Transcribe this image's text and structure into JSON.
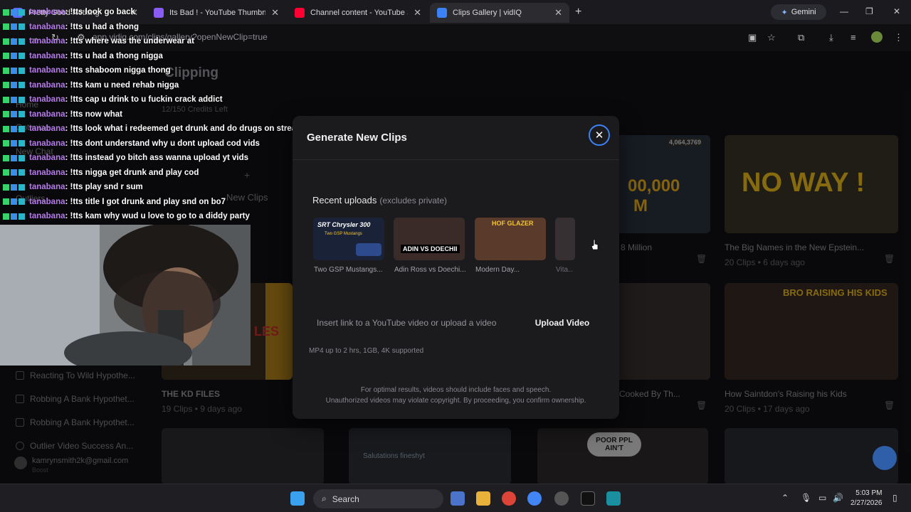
{
  "browser": {
    "tabs": [
      {
        "label": "Pretty Good Nothing",
        "icon": "globe-icon",
        "color": "#5a6dff",
        "active": false
      },
      {
        "label": "Its Bad ! - YouTube Thumbnail",
        "icon": "shield-icon",
        "color": "#8a5cf6",
        "active": false
      },
      {
        "label": "Channel content - YouTube Stu",
        "icon": "youtube-icon",
        "color": "#ff0033",
        "active": false
      },
      {
        "label": "Clips Gallery | vidIQ",
        "icon": "vidiq-icon",
        "color": "#3b82f6",
        "active": true
      }
    ],
    "new_tab": "+",
    "gemini_label": "Gemini",
    "url": "app.vidiq.com/clips/gallery?openNewClip=true"
  },
  "chat": {
    "lines": [
      {
        "user": "tanabana",
        "msg": ": !tts look go back"
      },
      {
        "user": "tanabana",
        "msg": ": !tts u had a thong"
      },
      {
        "user": "tanabana",
        "msg": ": !tts where was the underwear at"
      },
      {
        "user": "tanabana",
        "msg": ": !tts u had a thong nigga"
      },
      {
        "user": "tanabana",
        "msg": ": !tts shaboom nigga thong"
      },
      {
        "user": "tanabana",
        "msg": ": !tts kam u need rehab nigga"
      },
      {
        "user": "tanabana",
        "msg": ": !tts cap u drink to u fuckin crack addict"
      },
      {
        "user": "tanabana",
        "msg": ": !tts now what"
      },
      {
        "user": "tanabana",
        "msg": ": !tts look what i redeemed get drunk and do drugs on stream"
      },
      {
        "user": "tanabana",
        "msg": ": !tts dont understand why u dont upload cod vids"
      },
      {
        "user": "tanabana",
        "msg": ": !tts instead yo bitch ass wanna upload yt vids"
      },
      {
        "user": "tanabana",
        "msg": ": !tts nigga get drunk and play cod"
      },
      {
        "user": "tanabana",
        "msg": ": !tts play snd r sum"
      },
      {
        "user": "tanabana",
        "msg": ": !tts title I got drunk and play snd on bo7"
      },
      {
        "user": "tanabana",
        "msg": ": !tts kam why wud u love to go to a diddy party"
      }
    ]
  },
  "page": {
    "title": "Clipping",
    "credits": "12/150 Credits Left",
    "sidebar": [
      "Home",
      "Optimize",
      "New Chat",
      "Outliers"
    ],
    "history": [
      "Reacting To Wild Hypothe...",
      "Robbing A Bank Hypothet...",
      "Robbing A Bank Hypothet...",
      "Outlier Video Success An..."
    ],
    "account": "kamrynsmith2k@gmail.com",
    "account_plan": "Boost",
    "new_clips": "New Clips",
    "cards": [
      {
        "title": "8 Million",
        "meta": ""
      },
      {
        "title": "The Big Names in the New Epstein...",
        "meta": "20 Clips • 6 days ago"
      },
      {
        "title": "THE KD FILES",
        "meta": "19 Clips • 9 days ago"
      },
      {
        "title": "Cooked By Th...",
        "meta": ""
      },
      {
        "title": "How Saintdon's Raising his Kids",
        "meta": "20 Clips • 17 days ago"
      }
    ],
    "thumb_texts": {
      "noway": "NO WAY !",
      "money": "00,000",
      "money2": "M",
      "counter": "4,064,3769",
      "kids": "BRO RAISING HIS KIDS",
      "poor": "POOR PPL AIN'T",
      "salutations": "Salutations fineshyt",
      "les": "LES"
    }
  },
  "modal": {
    "title": "Generate New Clips",
    "recent_label": "Recent uploads",
    "recent_sub": "(excludes private)",
    "uploads": [
      {
        "label": "Two GSP Mustangs...",
        "thumb_text": "SRT Chrysler 300",
        "thumb_sub": "Two GSP Mustangs"
      },
      {
        "label": "Adin Ross vs Doechi...",
        "thumb_text": "ADIN VS DOECHII"
      },
      {
        "label": "Modern Day...",
        "thumb_text": "HOF GLAZER"
      },
      {
        "label": "Vita..."
      }
    ],
    "input_placeholder": "Insert link to a YouTube video or upload a video",
    "upload_button": "Upload Video",
    "formats": "MP4 up to 2 hrs, 1GB, 4K supported",
    "disclaimer_1": "For optimal results, videos should include faces and speech.",
    "disclaimer_2": "Unauthorized videos may violate copyright. By proceeding, you confirm ownership."
  },
  "taskbar": {
    "search": "Search",
    "time": "5:03 PM",
    "date": "2/27/2026"
  }
}
